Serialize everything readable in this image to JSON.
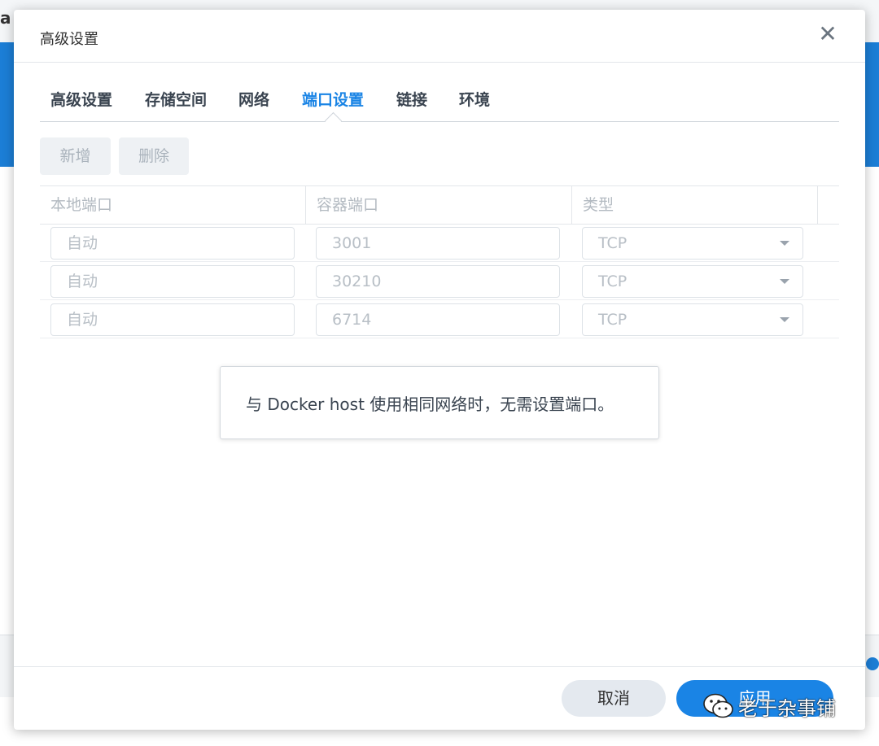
{
  "background": {
    "app_title_fragment": "a"
  },
  "dialog": {
    "title": "高级设置",
    "close_symbol": "✕"
  },
  "tabs": [
    {
      "label": "高级设置",
      "active": false
    },
    {
      "label": "存储空间",
      "active": false
    },
    {
      "label": "网络",
      "active": false
    },
    {
      "label": "端口设置",
      "active": true
    },
    {
      "label": "链接",
      "active": false
    },
    {
      "label": "环境",
      "active": false
    }
  ],
  "toolbar": {
    "add_label": "新增",
    "delete_label": "删除"
  },
  "port_table": {
    "columns": [
      "本地端口",
      "容器端口",
      "类型"
    ],
    "rows": [
      {
        "local_port": "自动",
        "container_port": "3001",
        "type": "TCP"
      },
      {
        "local_port": "自动",
        "container_port": "30210",
        "type": "TCP"
      },
      {
        "local_port": "自动",
        "container_port": "6714",
        "type": "TCP"
      }
    ]
  },
  "info_message": "与 Docker host 使用相同网络时，无需设置端口。",
  "footer": {
    "cancel_label": "取消",
    "apply_label": "应用"
  },
  "watermark": {
    "text": "老于杂事铺",
    "icon": "wechat-icon"
  },
  "colors": {
    "accent": "#1a84e5",
    "background_banner": "#1c7ed6"
  }
}
